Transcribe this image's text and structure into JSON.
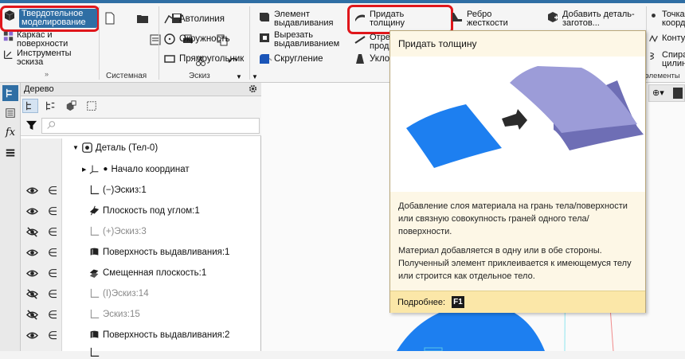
{
  "colors": {
    "accent": "#2f6ea4",
    "highlight": "#e0161b",
    "tooltip_bg": "#fdf7e6",
    "tooltip_footer": "#fbe7a8",
    "surface_blue": "#1d7ff0",
    "surface_violet": "#9a9ad6"
  },
  "ribbon": {
    "mode_button": {
      "label": "Твердотельное моделирование",
      "icon": "solid-cube-icon"
    },
    "left_items": [
      {
        "label": "Каркас и поверхности",
        "icon": "surface-icon"
      },
      {
        "label": "Инструменты эскиза",
        "icon": "sketch-tools-icon"
      }
    ],
    "groups": {
      "system": "Системная",
      "sketch": "Эскиз"
    },
    "sketch_tools": [
      "Автолиния",
      "Окружность",
      "Прямоугольник"
    ],
    "features_col1": [
      "Элемент выдавливания",
      "Вырезать выдавливанием",
      "Скругление"
    ],
    "features_col2": [
      "Придать толщину",
      "Отрезать прод...",
      "Укло..."
    ],
    "features_col3": [
      "Ребро жесткости"
    ],
    "features_col4": [
      "Добавить деталь-заготов..."
    ],
    "right_col": [
      "Точка коорд...",
      "Конту...",
      "Спира цилин..."
    ],
    "right_group_label": "элементы к..."
  },
  "tree": {
    "title": "Дерево",
    "search_placeholder": "",
    "root": "Деталь (Тел-0)",
    "rows": [
      {
        "label": "Начало координат",
        "hidden": false
      },
      {
        "label": "(−)Эскиз:1",
        "hidden": false
      },
      {
        "label": "Плоскость под углом:1",
        "hidden": false
      },
      {
        "label": "(+)Эскиз:3",
        "hidden": true
      },
      {
        "label": "Поверхность выдавливания:1",
        "hidden": false
      },
      {
        "label": "Смещенная плоскость:1",
        "hidden": false
      },
      {
        "label": "(I)Эскиз:14",
        "hidden": true
      },
      {
        "label": "Эскиз:15",
        "hidden": true
      },
      {
        "label": "Поверхность выдавливания:2",
        "hidden": false
      }
    ]
  },
  "tooltip": {
    "title": "Придать толщину",
    "desc1": "Добавление слоя материала на грань тела/поверхности или связную совокупность граней одного тела/поверхности.",
    "desc2": "Материал добавляется в одну или в обе стороны. Полученный элемент приклеивается к имеющемуся телу или строится как отдельное тело.",
    "more_label": "Подробнее:",
    "hotkey": "F1"
  },
  "left_panel": {
    "fx_label": "fx"
  }
}
